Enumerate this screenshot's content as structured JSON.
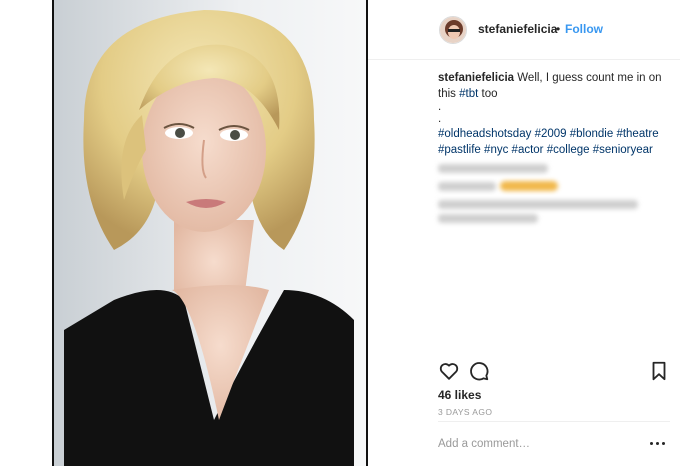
{
  "post": {
    "username": "stefaniefelicia",
    "separator": "•",
    "follow_label": "Follow",
    "caption": {
      "username": "stefaniefelicia",
      "text_line1": "Well, I guess count me in on",
      "text_line2_prefix": "this",
      "line2_tag": "#tbt",
      "text_line2_suffix": "too",
      "dot1": ".",
      "dot2": ".",
      "hashtags_line1": [
        "#oldheadshotsday",
        "#2009",
        "#blondie",
        "#theatre"
      ],
      "hashtags_line2": [
        "#pastlife",
        "#nyc",
        "#actor",
        "#college",
        "#senioryear"
      ]
    },
    "likes": "46 likes",
    "time_ago": "3 DAYS AGO",
    "comment_placeholder": "Add a comment…"
  },
  "icons": {
    "like": "heart-icon",
    "comment": "speech-bubble-icon",
    "save": "bookmark-icon",
    "more": "more-options-icon"
  },
  "colors": {
    "link_blue": "#3897f0",
    "hashtag_navy": "#003569",
    "muted_gray": "#999999",
    "text": "#262626"
  }
}
